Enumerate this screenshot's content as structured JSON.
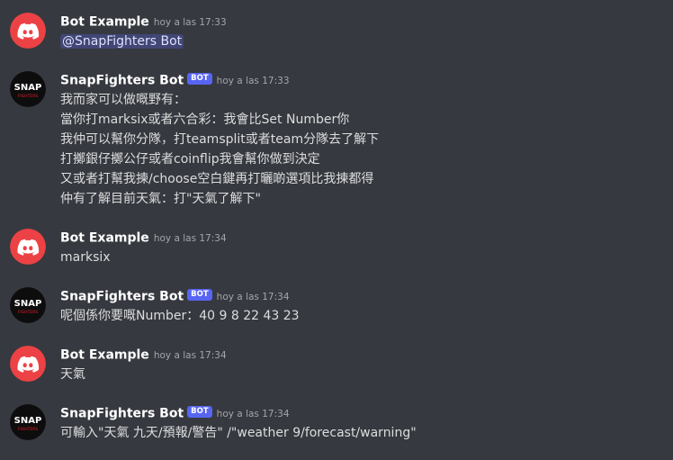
{
  "messages": [
    {
      "author": "Bot Example",
      "is_bot": false,
      "timestamp": "hoy a las 17:33",
      "mention": "@SnapFighters Bot",
      "lines": []
    },
    {
      "author": "SnapFighters Bot",
      "is_bot": true,
      "badge": "BOT",
      "timestamp": "hoy a las 17:33",
      "lines": [
        "我而家可以做嘅野有：",
        "當你打marksix或者六合彩：我會比Set Number你",
        "我仲可以幫你分隊，打teamsplit或者team分隊去了解下",
        "打擲銀仔擲公仔或者coinflip我會幫你做到決定",
        "又或者打幫我揀/choose空白鍵再打曬啲選項比我揀都得",
        "仲有了解目前天氣：打\"天氣了解下\""
      ]
    },
    {
      "author": "Bot Example",
      "is_bot": false,
      "timestamp": "hoy a las 17:34",
      "lines": [
        "marksix"
      ]
    },
    {
      "author": "SnapFighters Bot",
      "is_bot": true,
      "badge": "BOT",
      "timestamp": "hoy a las 17:34",
      "lines": [
        "呢個係你要嘅Number：40 9 8 22 43 23"
      ]
    },
    {
      "author": "Bot Example",
      "is_bot": false,
      "timestamp": "hoy a las 17:34",
      "lines": [
        "天氣"
      ]
    },
    {
      "author": "SnapFighters Bot",
      "is_bot": true,
      "badge": "BOT",
      "timestamp": "hoy a las 17:34",
      "lines": [
        "可輸入\"天氣 九天/預報/警告\" /\"weather 9/forecast/warning\""
      ]
    }
  ],
  "avatars": {
    "discord_color": "#ed4245",
    "snap_logo_text_top": "SNAP",
    "snap_logo_text_bottom": "FIGHTERS",
    "snap_logo_accent": "#e0202a"
  },
  "colors": {
    "background": "#36393f",
    "bot_badge": "#5865f2",
    "mention_bg": "#414675"
  }
}
